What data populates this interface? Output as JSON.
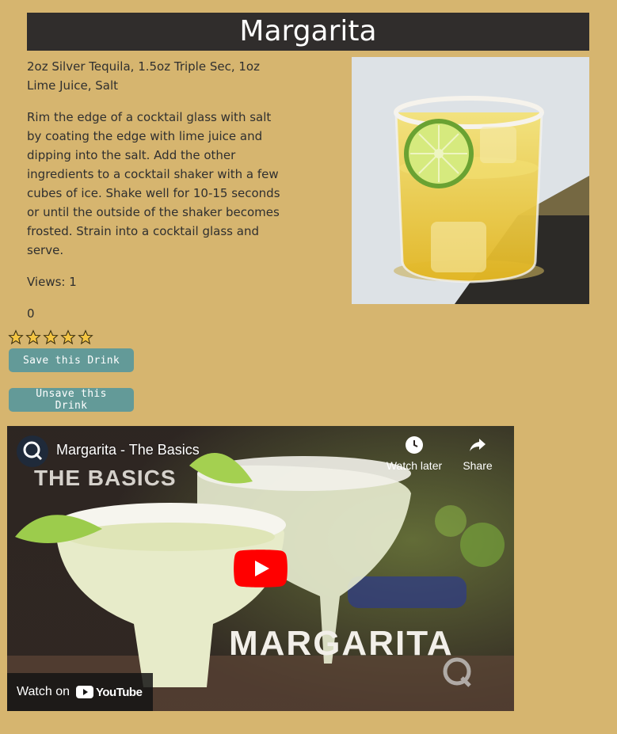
{
  "page": {
    "title": "Margarita",
    "ingredients": "2oz Silver Tequila, 1.5oz Triple Sec, 1oz Lime Juice, Salt",
    "instructions": "Rim the edge of a cocktail glass with salt by coating the edge with lime juice and dipping into the salt. Add the other ingredients to a cocktail shaker with a few cubes of ice. Shake well for 10-15 seconds or until the outside of the shaker becomes frosted. Strain into a cocktail glass and serve.",
    "views": "Views: 1",
    "rating_value": "0",
    "rating_stars_total": 5
  },
  "buttons": {
    "save_label": "Save this Drink",
    "unsave_label": "Unsave this Drink"
  },
  "video": {
    "title": "Margarita - The Basics",
    "watch_later": "Watch later",
    "share": "Share",
    "watch_on": "Watch on",
    "youtube": "YouTube",
    "thumb_text_top": "THE BASICS",
    "thumb_text_main": "MARGARITA"
  },
  "colors": {
    "background": "#d6b56f",
    "title_bar": "#302d2c",
    "button": "#639a98",
    "star_fill": "#f4c542"
  }
}
